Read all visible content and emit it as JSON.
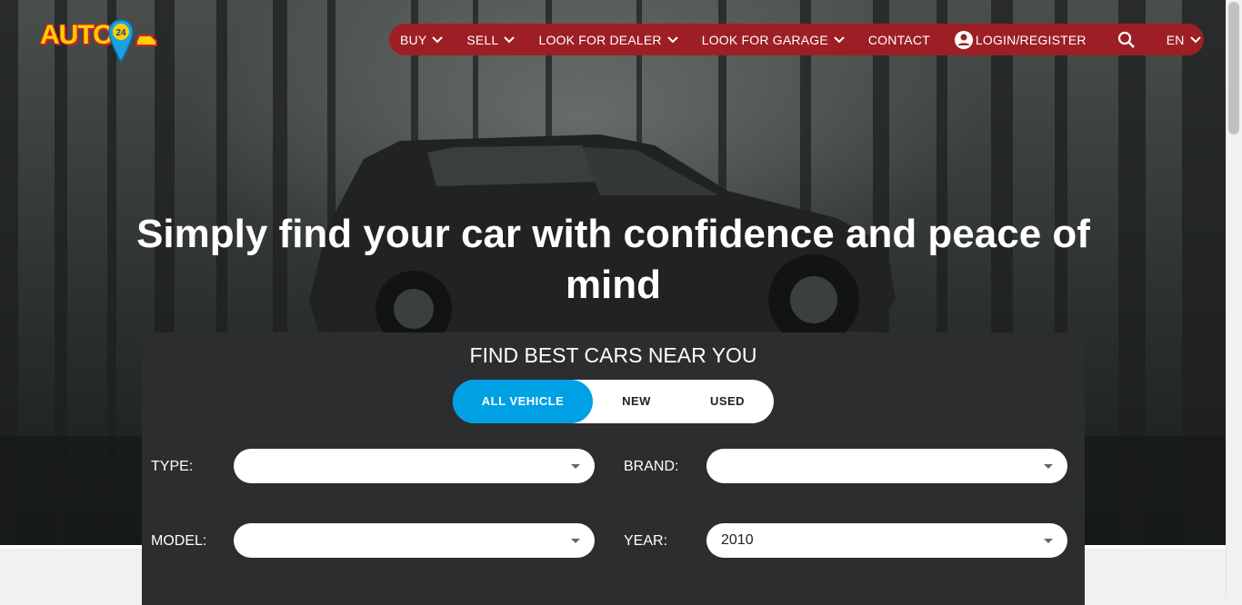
{
  "brand": {
    "logo_text": "AUTO",
    "logo_badge": "24"
  },
  "nav": {
    "buy": "BUY",
    "sell": "SELL",
    "dealer": "LOOK FOR DEALER",
    "garage": "LOOK FOR GARAGE",
    "contact": "CONTACT",
    "login": "LOGIN/REGISTER",
    "lang": "EN"
  },
  "hero": {
    "headline": "Simply find your car with confidence and peace of mind"
  },
  "search": {
    "title": "FIND BEST CARS NEAR YOU",
    "tabs": {
      "all": "ALL VEHICLE",
      "new": "NEW",
      "used": "USED"
    },
    "labels": {
      "type": "TYPE:",
      "brand": "BRAND:",
      "model": "MODEL:",
      "year": "YEAR:"
    },
    "values": {
      "type": "",
      "brand": "",
      "model": "",
      "year": "2010"
    }
  },
  "colors": {
    "nav_bg": "#9d1f25",
    "accent": "#00a1e4",
    "panel_bg": "#2b2d2e"
  }
}
